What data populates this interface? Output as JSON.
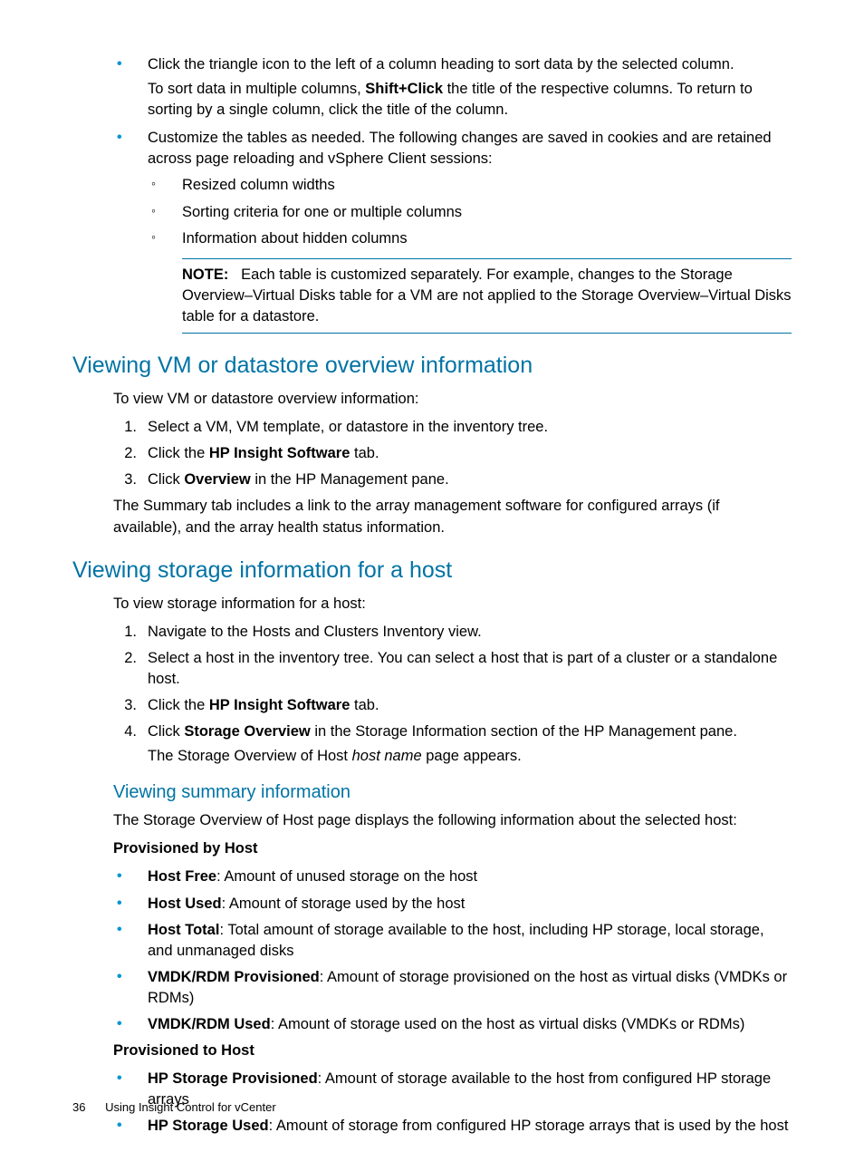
{
  "top_bullets": [
    {
      "main": "Click the triangle icon to the left of a column heading to sort data by the selected column.",
      "extra_pre": "To sort data in multiple columns, ",
      "extra_bold": "Shift+Click",
      "extra_post": " the title of the respective columns. To return to sorting by a single column, click the title of the column."
    },
    {
      "main": "Customize the tables as needed. The following changes are saved in cookies and are retained across page reloading and vSphere Client sessions:",
      "subs": [
        "Resized column widths",
        "Sorting criteria for one or multiple columns",
        "Information about hidden columns"
      ]
    }
  ],
  "note": {
    "label": "NOTE:",
    "text": "Each table is customized separately. For example, changes to the Storage Overview–Virtual Disks table for a VM are not applied to the Storage Overview–Virtual Disks table for a datastore."
  },
  "sec1": {
    "heading": "Viewing VM or datastore overview information",
    "intro": "To view VM or datastore overview information:",
    "steps": [
      {
        "n": "1.",
        "text": "Select a VM, VM template, or datastore in the inventory tree."
      },
      {
        "n": "2.",
        "pre": "Click the ",
        "bold": "HP Insight Software",
        "post": " tab."
      },
      {
        "n": "3.",
        "pre": "Click ",
        "bold": "Overview",
        "post": " in the HP Management pane."
      }
    ],
    "outro": "The Summary tab includes a link to the array management software for configured arrays (if available), and the array health status information."
  },
  "sec2": {
    "heading": "Viewing storage information for a host",
    "intro": "To view storage information for a host:",
    "steps": [
      {
        "n": "1.",
        "text": "Navigate to the Hosts and Clusters Inventory view."
      },
      {
        "n": "2.",
        "text": "Select a host in the inventory tree. You can select a host that is part of a cluster or a standalone host."
      },
      {
        "n": "3.",
        "pre": "Click the ",
        "bold": "HP Insight Software",
        "post": " tab."
      },
      {
        "n": "4.",
        "pre": "Click ",
        "bold": "Storage Overview",
        "post": " in the Storage Information section of the HP Management pane.",
        "extra_pre": "The Storage Overview of Host ",
        "extra_italic": "host name",
        "extra_post": " page appears."
      }
    ]
  },
  "sub1": {
    "heading": "Viewing summary information",
    "intro": "The Storage Overview of Host page displays the following information about the selected host:",
    "g1_heading": "Provisioned by Host",
    "g1": [
      {
        "bold": "Host Free",
        "text": ": Amount of unused storage on the host"
      },
      {
        "bold": "Host Used",
        "text": ": Amount of storage used by the host"
      },
      {
        "bold": "Host Total",
        "text": ": Total amount of storage available to the host, including HP storage, local storage, and unmanaged disks"
      },
      {
        "bold": "VMDK/RDM Provisioned",
        "text": ": Amount of storage provisioned on the host as virtual disks (VMDKs or RDMs)"
      },
      {
        "bold": "VMDK/RDM Used",
        "text": ": Amount of storage used on the host as virtual disks (VMDKs or RDMs)"
      }
    ],
    "g2_heading": "Provisioned to Host",
    "g2": [
      {
        "bold": "HP Storage Provisioned",
        "text": ": Amount of storage available to the host from configured HP storage arrays"
      },
      {
        "bold": "HP Storage Used",
        "text": ": Amount of storage from configured HP storage arrays that is used by the host"
      }
    ]
  },
  "footer": {
    "page": "36",
    "title": "Using Insight Control for vCenter"
  }
}
